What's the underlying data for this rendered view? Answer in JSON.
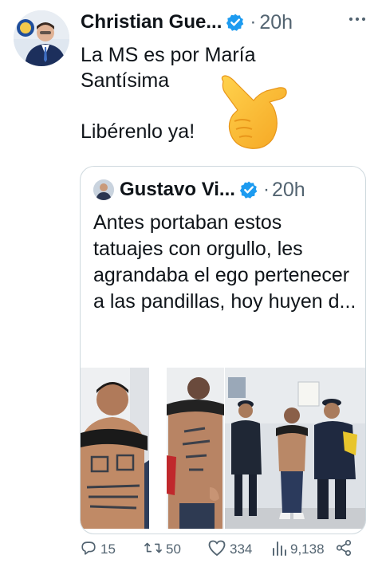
{
  "tweet": {
    "author_name": "Christian Gue...",
    "verified_icon": "verified-badge-icon",
    "separator": "·",
    "time": "20h",
    "more_icon": "more-icon",
    "text": "La MS es por María\nSantísima\n\nLibérenlo ya!",
    "emoji": "pointing-hand-emoji"
  },
  "quote": {
    "author_name": "Gustavo Vi...",
    "separator": "·",
    "time": "20h",
    "text": "Antes portaban estos tatuajes con orgullo, les agrandaba el ego pertenecer a las pandillas, hoy huyen d...",
    "photos": [
      "tattooed-man-front-photo",
      "tattooed-man-back-photo",
      "police-escort-photo"
    ]
  },
  "actions": {
    "replies": "15",
    "retweets": "50",
    "likes": "334",
    "views": "9,138"
  },
  "colors": {
    "text": "#0f1419",
    "secondary": "#536471",
    "verified": "#1d9bf0",
    "border": "#cfd9de"
  }
}
